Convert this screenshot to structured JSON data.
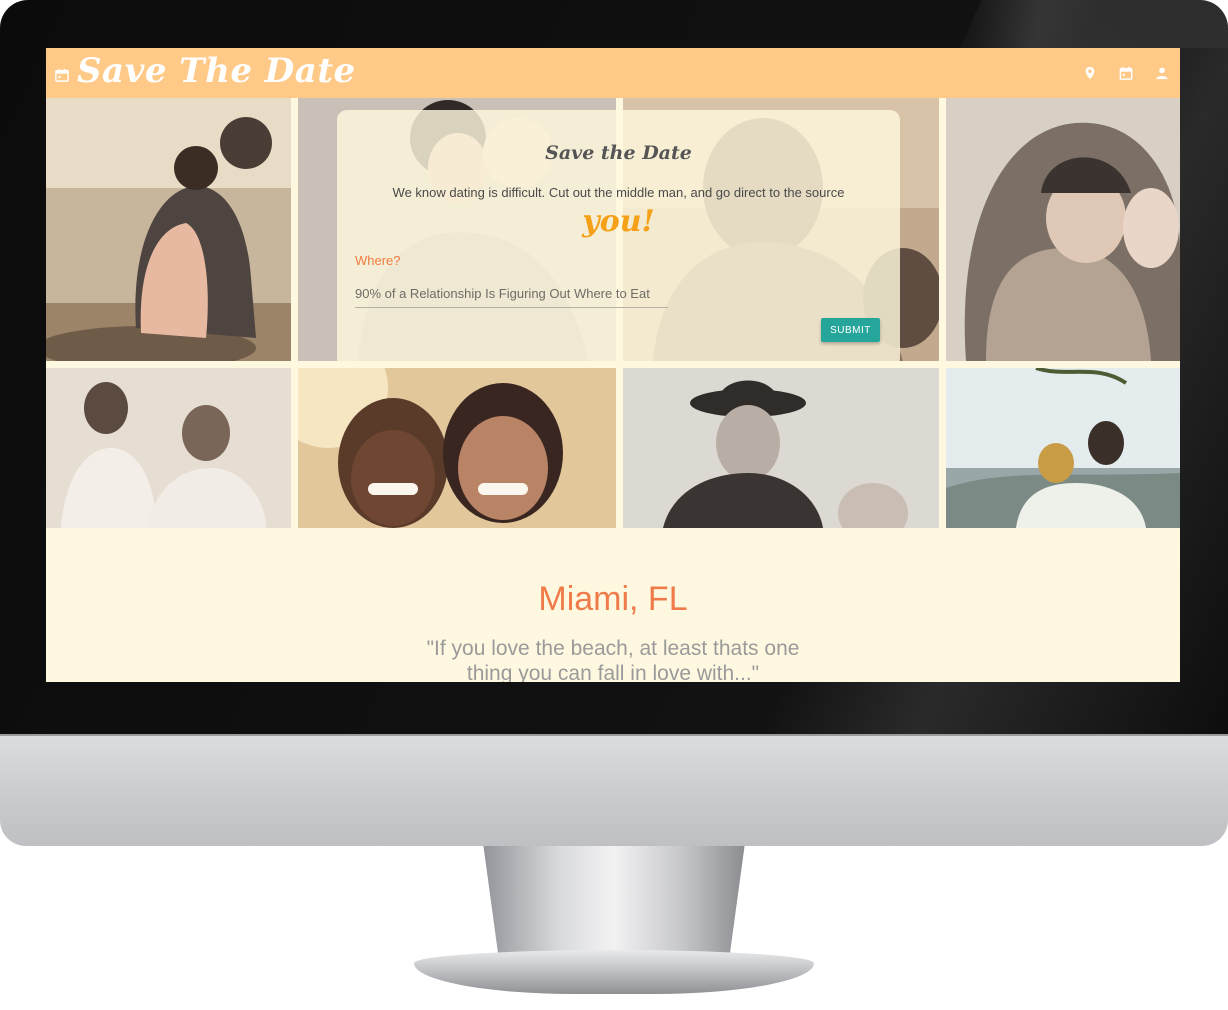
{
  "navbar": {
    "brand": "Save The Date",
    "brand_icon": "calendar-icon",
    "icons": [
      "location-pin-icon",
      "calendar-icon",
      "person-icon"
    ],
    "background": "#ffc987"
  },
  "form_card": {
    "title": "Save the Date",
    "subtitle": "We know dating is difficult. Cut out the middle man, and go direct to the source",
    "emphasis": "you!",
    "where_label": "Where?",
    "where_placeholder": "90% of a Relationship Is Figuring Out Where to Eat",
    "submit_label": "SUBMIT"
  },
  "featured": {
    "city": "Miami, FL",
    "quote": "\"If you love the beach, at least thats one thing you can fall in love with...\""
  },
  "colors": {
    "accent_orange": "#f07b4a",
    "button_teal": "#26a69a",
    "page_background": "#fff8e1",
    "emphasis_yellow": "#f5a016"
  }
}
